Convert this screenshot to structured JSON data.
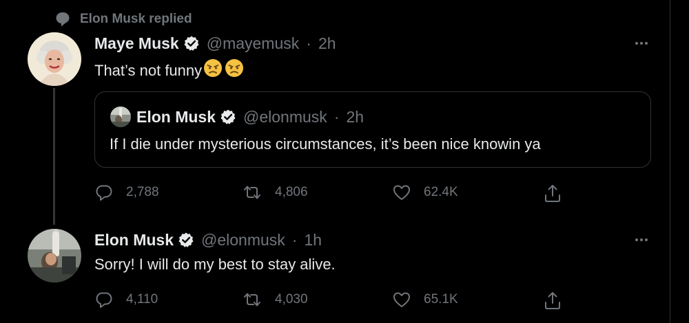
{
  "context": {
    "icon": "speech-bubble-icon",
    "text": "Elon Musk replied"
  },
  "tweets": [
    {
      "author": {
        "name": "Maye Musk",
        "handle": "@mayemusk",
        "verified": true
      },
      "separator": "·",
      "time": "2h",
      "text": "That’s not funny",
      "emoji": [
        "😠",
        "😠"
      ],
      "quote": {
        "author": {
          "name": "Elon Musk",
          "handle": "@elonmusk",
          "verified": true
        },
        "separator": "·",
        "time": "2h",
        "text": "If I die under mysterious circumstances, it’s been nice knowin ya"
      },
      "stats": {
        "replies": "2,788",
        "retweets": "4,806",
        "likes": "62.4K"
      }
    },
    {
      "author": {
        "name": "Elon Musk",
        "handle": "@elonmusk",
        "verified": true
      },
      "separator": "·",
      "time": "1h",
      "text": "Sorry! I will do my best to stay alive.",
      "stats": {
        "replies": "4,110",
        "retweets": "4,030",
        "likes": "65.1K"
      }
    }
  ],
  "colors": {
    "background": "#000000",
    "text": "#e7e9ea",
    "muted": "#71767b",
    "border": "#2f3336",
    "verified_badge": "#e7e9ea",
    "emoji_face": "#f5c242"
  }
}
